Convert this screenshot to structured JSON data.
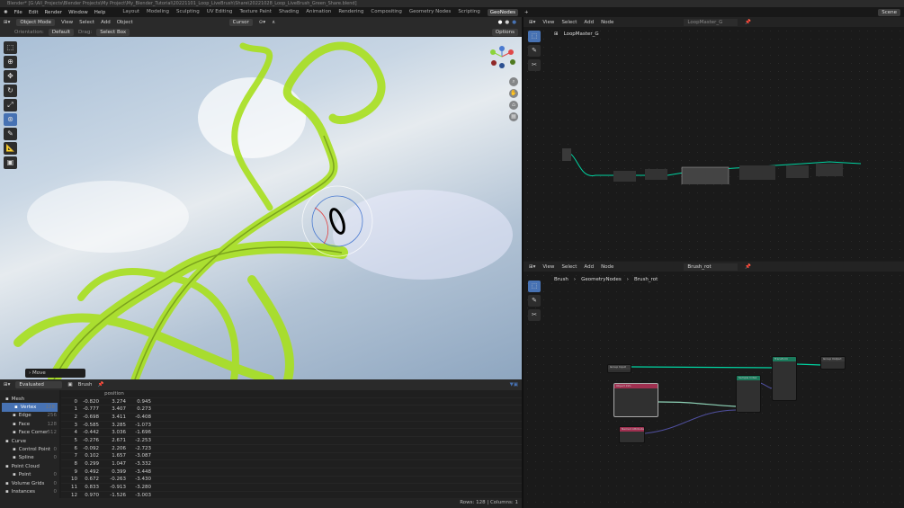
{
  "title": "Blender* [G:\\All_Projects\\Blender Projects\\My Project\\My_Blender_Tutorial\\20221101_Loop_LiveBrush\\Share\\20221028_Loop_LiveBrush_Green_Share.blend]",
  "menu": [
    "File",
    "Edit",
    "Render",
    "Window",
    "Help"
  ],
  "workspaces": [
    "Layout",
    "Modeling",
    "Sculpting",
    "UV Editing",
    "Texture Paint",
    "Shading",
    "Animation",
    "Rendering",
    "Compositing",
    "Geometry Nodes",
    "Scripting",
    "GeoNodes"
  ],
  "scene": "Scene",
  "viewport": {
    "mode": "Object Mode",
    "menus": [
      "View",
      "Select",
      "Add",
      "Object"
    ],
    "pivot": "Cursor",
    "orientation_label": "Orientation:",
    "orientation": "Default",
    "drag_label": "Drag:",
    "drag": "Select Box",
    "options": "Options",
    "last_op": "Move"
  },
  "spreadsheet": {
    "mode": "Evaluated",
    "object": "Brush",
    "column": "position",
    "tree": [
      {
        "label": "Mesh",
        "count": "",
        "sub": false,
        "icon": "mesh-icon"
      },
      {
        "label": "Vertex",
        "count": "128",
        "sub": true,
        "active": true,
        "icon": "vertex-icon"
      },
      {
        "label": "Edge",
        "count": "256",
        "sub": true,
        "icon": "edge-icon"
      },
      {
        "label": "Face",
        "count": "128",
        "sub": true,
        "icon": "face-icon"
      },
      {
        "label": "Face Corner",
        "count": "512",
        "sub": true,
        "icon": "face-corner-icon"
      },
      {
        "label": "Curve",
        "count": "",
        "sub": false,
        "icon": "curve-icon"
      },
      {
        "label": "Control Point",
        "count": "0",
        "sub": true,
        "icon": "control-point-icon"
      },
      {
        "label": "Spline",
        "count": "0",
        "sub": true,
        "icon": "spline-icon"
      },
      {
        "label": "Point Cloud",
        "count": "",
        "sub": false,
        "icon": "point-cloud-icon"
      },
      {
        "label": "Point",
        "count": "0",
        "sub": true,
        "icon": "point-icon"
      },
      {
        "label": "Volume Grids",
        "count": "0",
        "sub": false,
        "icon": "volume-icon"
      },
      {
        "label": "Instances",
        "count": "0",
        "sub": false,
        "icon": "instances-icon"
      }
    ],
    "rows": [
      [
        "0",
        "-0.820",
        "3.274",
        "0.945"
      ],
      [
        "1",
        "-0.777",
        "3.407",
        "0.273"
      ],
      [
        "2",
        "-0.698",
        "3.411",
        "-0.408"
      ],
      [
        "3",
        "-0.585",
        "3.285",
        "-1.073"
      ],
      [
        "4",
        "-0.442",
        "3.036",
        "-1.696"
      ],
      [
        "5",
        "-0.276",
        "2.671",
        "-2.253"
      ],
      [
        "6",
        "-0.092",
        "2.206",
        "-2.723"
      ],
      [
        "7",
        "0.102",
        "1.657",
        "-3.087"
      ],
      [
        "8",
        "0.299",
        "1.047",
        "-3.332"
      ],
      [
        "9",
        "0.492",
        "0.399",
        "-3.448"
      ],
      [
        "10",
        "0.672",
        "-0.263",
        "-3.430"
      ],
      [
        "11",
        "0.833",
        "-0.913",
        "-3.280"
      ],
      [
        "12",
        "0.970",
        "-1.526",
        "-3.003"
      ]
    ],
    "footer": "Rows: 128   |   Columns: 1"
  },
  "node_top": {
    "menus": [
      "View",
      "Select",
      "Add",
      "Node"
    ],
    "tree": "LoopMaster_G",
    "breadcrumb": "LoopMaster_G"
  },
  "node_bottom": {
    "menus": [
      "View",
      "Select",
      "Add",
      "Node"
    ],
    "tree": "Brush_rot",
    "breadcrumb": [
      "Brush",
      "GeometryNodes",
      "Brush_rot"
    ],
    "nodes": [
      "Group Input",
      "Object Info",
      "Named Attribute",
      "Sample Index",
      "Transform",
      "Group Output"
    ]
  },
  "colors": {
    "accent": "#4772b3",
    "geometry_link": "#00d6a3",
    "brush_green": "#a8e01e"
  }
}
